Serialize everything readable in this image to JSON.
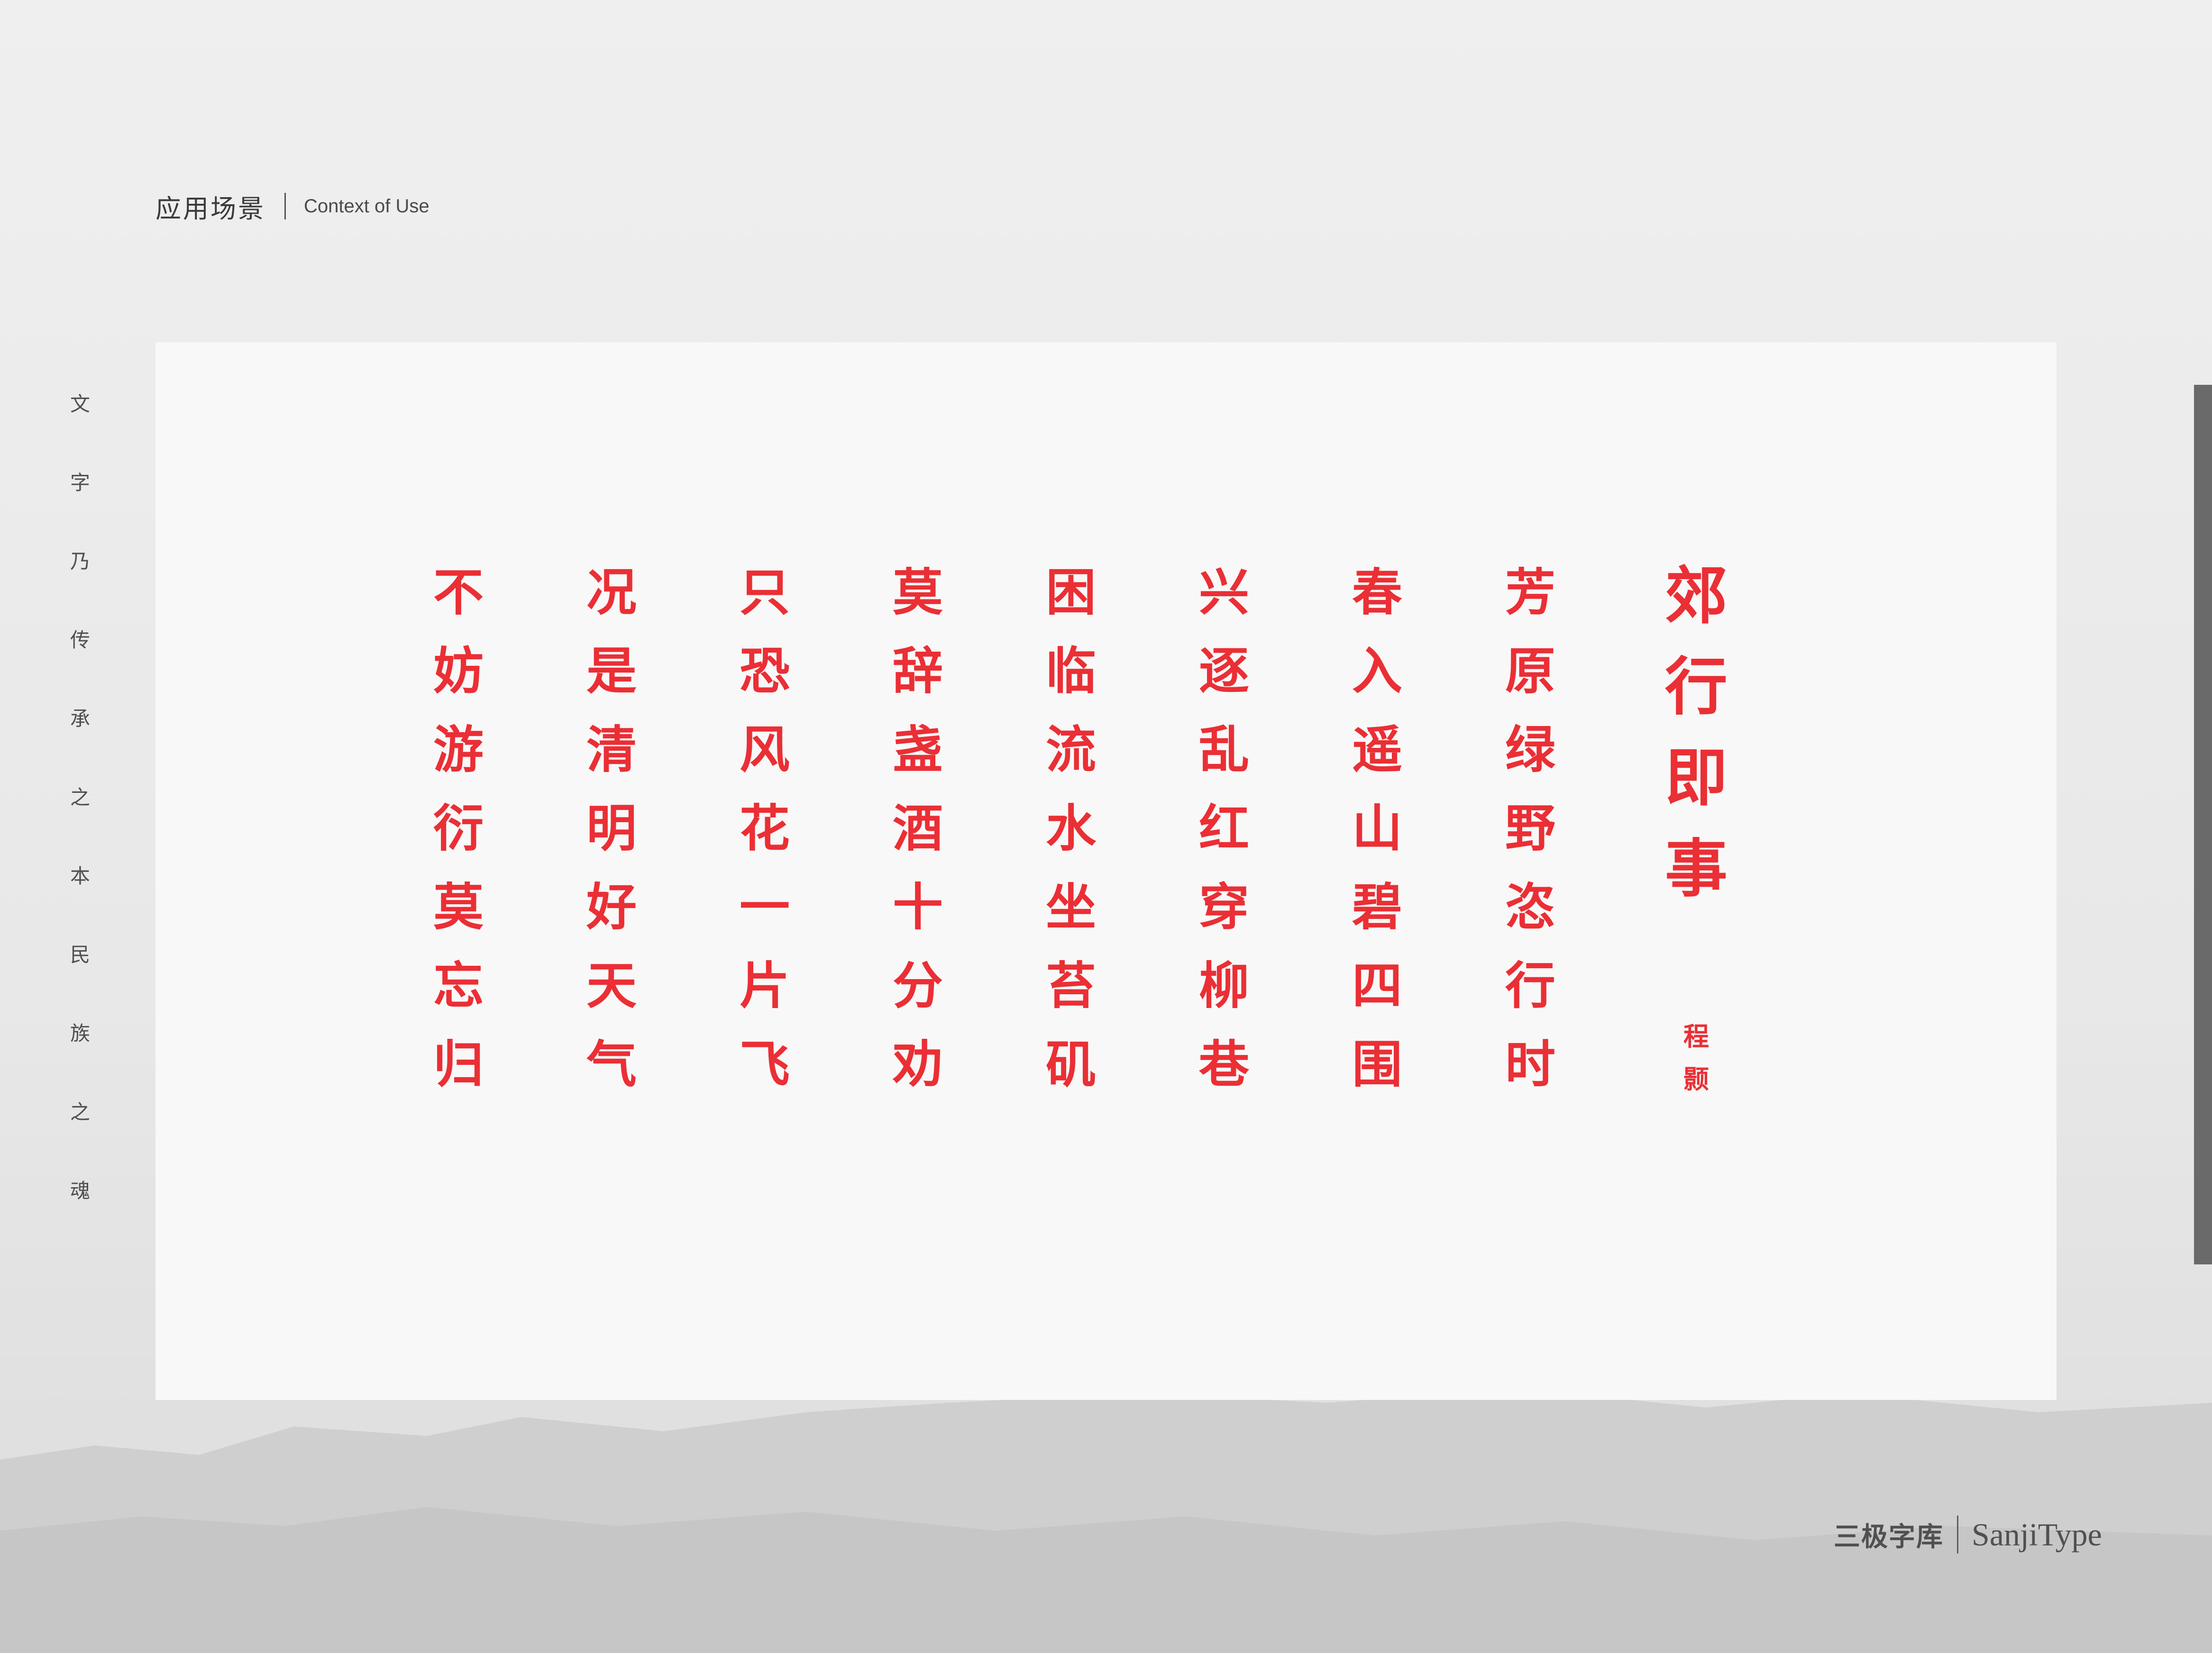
{
  "header": {
    "title": "应用场景",
    "subtitle": "Context of Use"
  },
  "slogan": [
    "文",
    "字",
    "乃",
    "传",
    "承",
    "之",
    "本",
    "民",
    "族",
    "之",
    "魂"
  ],
  "poem": {
    "title": "郊行即事",
    "author": "程颢",
    "lines": [
      "芳原绿野恣行时",
      "春入遥山碧四围",
      "兴逐乱红穿柳巷",
      "困临流水坐苔矶",
      "莫辞盏酒十分劝",
      "只恐风花一片飞",
      "况是清明好天气",
      "不妨游衍莫忘归"
    ],
    "color": "#ea2f35"
  },
  "footer": {
    "brand_cn": "三极字库",
    "brand_en": "SanjiType"
  }
}
